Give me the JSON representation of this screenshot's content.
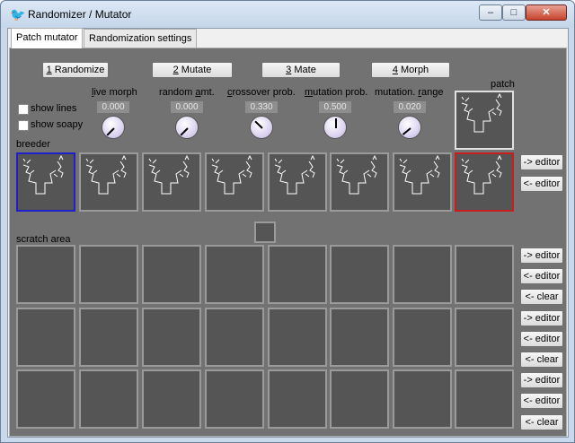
{
  "window": {
    "title": "Randomizer / Mutator",
    "icon": "bird-icon"
  },
  "tabs": [
    {
      "label": "Patch mutator",
      "active": true
    },
    {
      "label": "Randomization settings",
      "active": false
    }
  ],
  "actions": {
    "randomize": {
      "num": "1",
      "text": " Randomize"
    },
    "mutate": {
      "num": "2",
      "text": " Mutate"
    },
    "mate": {
      "num": "3",
      "text": " Mate"
    },
    "morph": {
      "num": "4",
      "text": " Morph"
    }
  },
  "checkboxes": {
    "show_lines": {
      "label": "show lines",
      "checked": false
    },
    "show_soapy": {
      "label": "show soapy",
      "checked": false
    }
  },
  "knobs": [
    {
      "label_u": "l",
      "label_rest": "ive morph",
      "value": "0.000",
      "level": 0.0
    },
    {
      "label_u": "",
      "label_pre": "random ",
      "label_u2": "a",
      "label_rest": "mt.",
      "value": "0.000",
      "level": 0.0
    },
    {
      "label_u": "c",
      "label_rest": "rossover prob.",
      "value": "0.330",
      "level": 0.33
    },
    {
      "label_u": "m",
      "label_rest": "utation prob.",
      "value": "0.500",
      "level": 0.5
    },
    {
      "label_pre": "mutation. ",
      "label_u2": "r",
      "label_rest": "ange",
      "value": "0.020",
      "level": 0.02
    }
  ],
  "labels": {
    "patch": "patch",
    "breeder": "breeder",
    "scratch": "scratch area"
  },
  "side_buttons": {
    "to_editor": "-> editor",
    "from_editor": "<- editor",
    "clear": "<- clear"
  },
  "colors": {
    "selected_left": "#2020c8",
    "selected_right": "#c81e1e",
    "panel_bg": "#727272",
    "cell_bg": "#555555"
  }
}
